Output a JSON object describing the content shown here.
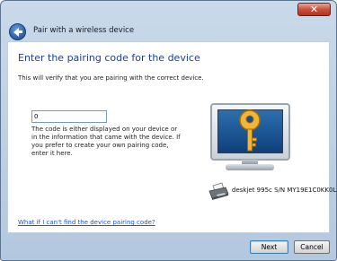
{
  "window": {
    "title": "Pair with a wireless device",
    "close_label": "✕"
  },
  "content": {
    "heading": "Enter the pairing code for the device",
    "subtitle": "This will verify that you are pairing with the correct device.",
    "pairing_code_value": "0",
    "help_text": "The code is either displayed on your device or in the information that came with the device. If you prefer to create your own pairing code, enter it here.",
    "device_label": "deskjet 995c S/N MY19E1C0KK0L",
    "help_link": "What if I can't find the device pairing code?"
  },
  "footer": {
    "next_label": "Next",
    "cancel_label": "Cancel"
  },
  "icons": {
    "back": "back-arrow-icon",
    "key": "key-icon",
    "monitor": "monitor-icon",
    "printer": "printer-icon"
  },
  "colors": {
    "heading": "#1f3f8c",
    "link": "#1e55c9",
    "key": "#e8a828",
    "screen": "#0f3f7c"
  }
}
